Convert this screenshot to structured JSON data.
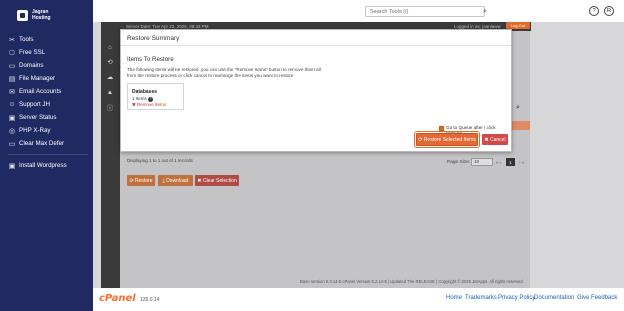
{
  "sidebar": {
    "brand": [
      "Jagran",
      "Hosting"
    ],
    "items": [
      {
        "label": "Tools",
        "icon": "✂"
      },
      {
        "label": "Free SSL",
        "icon": "🔒"
      },
      {
        "label": "Domains",
        "icon": "▭"
      },
      {
        "label": "File Manager",
        "icon": "▤"
      },
      {
        "label": "Email Accounts",
        "icon": "✉"
      },
      {
        "label": "Support JH",
        "icon": "☺"
      },
      {
        "label": "Server Status",
        "icon": "▣"
      },
      {
        "label": "PHP X-Ray",
        "icon": "◎"
      },
      {
        "label": "Clear Max Defer",
        "icon": "▭"
      },
      {
        "label": "Install Wordpress",
        "icon": "▣"
      }
    ]
  },
  "topbar": {
    "search_placeholder": "Search Tools (/)",
    "btn_q": "?",
    "btn_r": "R"
  },
  "background": {
    "server_date": "Server Date: Tue Apr 22, 2025, 09:43 PM",
    "logged_in": "Logged in as: jaanlaww",
    "logout": "Log Out",
    "displaying": "Displaying 1 to 1 out of 1 records",
    "page_size_label": "Page Size:",
    "page_size_value": "10",
    "pager_current": "1",
    "pager_first": "«  ‹",
    "pager_last": "›  »",
    "btn_restore": "⟳ Restore",
    "btn_download": "⤓ Download",
    "btn_clear": "✖ Clear Selection",
    "footer_text": "Base Version 5.2.14-5 cPanel Version 5.2.14-5 | Updated The RELEASE | Copyright © 2025 JetApps. All rights reserved."
  },
  "modal": {
    "title": "Restore Summary",
    "items_heading": "Items To Restore",
    "description": "The following items will be restored .you can use the \"Remove Items\" button to remove them all from the restore process or click cancel to rearrange the items you want to restore",
    "db_card": {
      "title": "Databases",
      "count": "1 Items",
      "remove": "Remove Items"
    },
    "queue_label": "Go to Queue after I click Restore",
    "restore_button": "⟳ Restore Selected Items",
    "cancel_button": "✖ Cancel"
  },
  "footer": {
    "logo": "cPanel",
    "version": "126.0.14",
    "links": [
      "Home",
      "Trademarks",
      "Privacy Policy",
      "Documentation",
      "Give Feedback"
    ]
  },
  "colors": {
    "sidebar_bg": "#1f2a63",
    "accent_orange": "#e36935",
    "cancel_red": "#d24a48",
    "link_blue": "#1f5db8"
  }
}
